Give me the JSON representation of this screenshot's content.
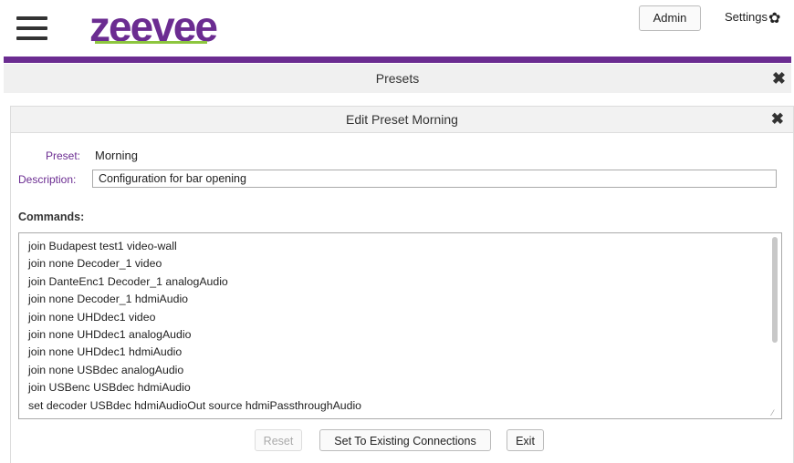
{
  "header": {
    "logo_text": "zeevee",
    "admin_label": "Admin",
    "settings_label": "Settings"
  },
  "presets_bar": {
    "title": "Presets",
    "close_glyph": "✖"
  },
  "dialog": {
    "title": "Edit Preset Morning",
    "close_glyph": "✖",
    "preset_label": "Preset:",
    "preset_value": "Morning",
    "description_label": "Description:",
    "description_value": "Configuration for bar opening",
    "commands_label": "Commands:",
    "commands": [
      "join Budapest test1 video-wall",
      "join none Decoder_1 video",
      "join DanteEnc1 Decoder_1 analogAudio",
      "join none Decoder_1 hdmiAudio",
      "join none UHDdec1 video",
      "join none UHDdec1 analogAudio",
      "join none UHDdec1 hdmiAudio",
      "join none USBdec analogAudio",
      "join USBenc USBdec hdmiAudio",
      "set decoder USBdec hdmiAudioOut source hdmiPassthroughAudio"
    ],
    "buttons": {
      "reset": "Reset",
      "set_existing": "Set To Existing Connections",
      "exit": "Exit"
    }
  },
  "colors": {
    "brand_purple": "#6b2c91",
    "brand_green": "#8dc63f"
  },
  "icons": {
    "menu": "hamburger-icon",
    "settings": "gear-icon",
    "close": "close-icon"
  }
}
